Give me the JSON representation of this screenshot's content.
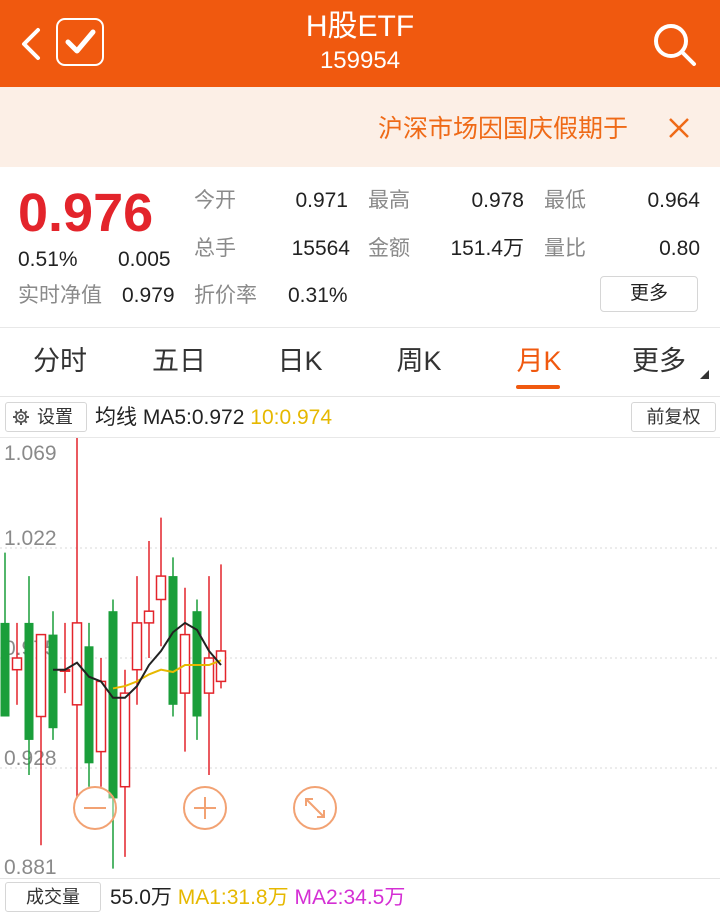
{
  "header": {
    "title": "H股ETF",
    "code": "159954",
    "bg_color": "#f0590f"
  },
  "notice": {
    "text": "沪深市场因国庆假期于"
  },
  "quote": {
    "price": "0.976",
    "change_pct": "0.51%",
    "change": "0.005",
    "nav_label": "实时净值",
    "nav_value": "0.979",
    "open_label": "今开",
    "open_value": "0.971",
    "high_label": "最高",
    "high_value": "0.978",
    "low_label": "最低",
    "low_value": "0.964",
    "volume_label": "总手",
    "volume_value": "15564",
    "amount_label": "金额",
    "amount_value": "151.4万",
    "ratio_label": "量比",
    "ratio_value": "0.80",
    "discount_label": "折价率",
    "discount_value": "0.31%",
    "more_label": "更多",
    "up_color": "#e3242b",
    "down_color": "#1a9e3a"
  },
  "tabs": [
    {
      "label": "分时"
    },
    {
      "label": "五日"
    },
    {
      "label": "日K"
    },
    {
      "label": "周K"
    },
    {
      "label": "月K",
      "active": true
    },
    {
      "label": "更多"
    }
  ],
  "chart_toolbar": {
    "settings_label": "设置",
    "ma_label": "均线",
    "ma5_text": "MA5:0.972",
    "ma10_text": "10:0.974",
    "adjust_label": "前复权"
  },
  "chart_data": {
    "type": "candlestick",
    "y_ticks": [
      "1.069",
      "1.022",
      "0.975",
      "0.928",
      "0.881"
    ],
    "ylim": [
      0.881,
      1.069
    ],
    "grid": true,
    "candles": [
      {
        "o": 0.99,
        "h": 1.02,
        "l": 0.96,
        "c": 0.95
      },
      {
        "o": 0.97,
        "h": 0.99,
        "l": 0.955,
        "c": 0.975
      },
      {
        "o": 0.99,
        "h": 1.01,
        "l": 0.925,
        "c": 0.94
      },
      {
        "o": 0.95,
        "h": 0.985,
        "l": 0.895,
        "c": 0.985
      },
      {
        "o": 0.985,
        "h": 0.995,
        "l": 0.94,
        "c": 0.945
      },
      {
        "o": 0.97,
        "h": 0.99,
        "l": 0.96,
        "c": 0.97
      },
      {
        "o": 0.955,
        "h": 1.07,
        "l": 0.915,
        "c": 0.99
      },
      {
        "o": 0.98,
        "h": 0.99,
        "l": 0.92,
        "c": 0.93
      },
      {
        "o": 0.935,
        "h": 0.975,
        "l": 0.92,
        "c": 0.965
      },
      {
        "o": 0.995,
        "h": 1.0,
        "l": 0.885,
        "c": 0.915
      },
      {
        "o": 0.92,
        "h": 0.97,
        "l": 0.89,
        "c": 0.96
      },
      {
        "o": 0.97,
        "h": 1.01,
        "l": 0.955,
        "c": 0.99
      },
      {
        "o": 0.99,
        "h": 1.025,
        "l": 0.975,
        "c": 0.995
      },
      {
        "o": 1.0,
        "h": 1.035,
        "l": 0.98,
        "c": 1.01
      },
      {
        "o": 1.01,
        "h": 1.018,
        "l": 0.95,
        "c": 0.955
      },
      {
        "o": 0.96,
        "h": 1.005,
        "l": 0.935,
        "c": 0.985
      },
      {
        "o": 0.995,
        "h": 1.0,
        "l": 0.94,
        "c": 0.95
      },
      {
        "o": 0.96,
        "h": 1.01,
        "l": 0.925,
        "c": 0.975
      },
      {
        "o": 0.965,
        "h": 1.015,
        "l": 0.962,
        "c": 0.978
      }
    ],
    "ma5": [
      null,
      null,
      null,
      null,
      0.97,
      0.97,
      0.973,
      0.967,
      0.965,
      0.958,
      0.958,
      0.963,
      0.972,
      0.978,
      0.986,
      0.99,
      0.987,
      0.978,
      0.972
    ],
    "ma10": [
      null,
      null,
      null,
      null,
      null,
      null,
      null,
      null,
      null,
      0.962,
      0.963,
      0.965,
      0.968,
      0.97,
      0.969,
      0.972,
      0.972,
      0.972,
      0.974
    ],
    "ma5_color": "#222222",
    "ma10_color": "#e6b800"
  },
  "zoom_controls": {
    "zoom_out": "−",
    "zoom_in": "+",
    "fullscreen": "fullscreen-icon"
  },
  "volume_bar": {
    "label": "成交量",
    "value": "55.0万",
    "ma1_text": "MA1:31.8万",
    "ma2_text": "MA2:34.5万"
  }
}
